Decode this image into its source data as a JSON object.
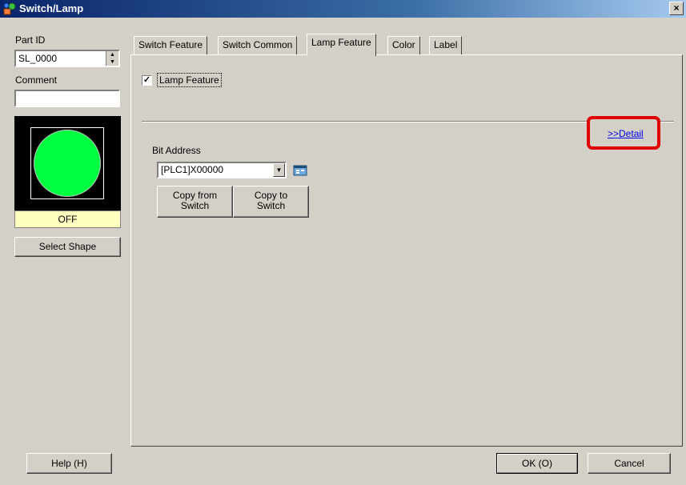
{
  "window": {
    "title": "Switch/Lamp",
    "close_glyph": "×"
  },
  "left_panel": {
    "part_id_label": "Part ID",
    "part_id_value": "SL_0000",
    "comment_label": "Comment",
    "comment_value": "",
    "preview": {
      "state_text": "OFF",
      "lamp_color": "#00ff40"
    },
    "select_shape_label": "Select Shape"
  },
  "tabs": [
    {
      "label": "Switch Feature",
      "active": false
    },
    {
      "label": "Switch Common",
      "active": false
    },
    {
      "label": "Lamp Feature",
      "active": true
    },
    {
      "label": "Color",
      "active": false
    },
    {
      "label": "Label",
      "active": false
    }
  ],
  "lamp_tab": {
    "lamp_feature_checkbox": {
      "label": "Lamp Feature",
      "checked": true,
      "mark": "✓"
    },
    "detail_link": ">>Detail",
    "bit_address_label": "Bit Address",
    "bit_address_value": "[PLC1]X00000",
    "copy_from_label": "Copy from\nSwitch",
    "copy_to_label": "Copy to\nSwitch"
  },
  "footer": {
    "help_label": "Help (H)",
    "ok_label": "OK (O)",
    "cancel_label": "Cancel"
  },
  "icons": {
    "app": "switch-lamp-app-icon",
    "address_picker": "address-input-icon",
    "dropdown": "dropdown-arrow-icon"
  },
  "colors": {
    "highlight": "#e00000",
    "link": "#0000ee",
    "title_bar": "#0a246a"
  }
}
